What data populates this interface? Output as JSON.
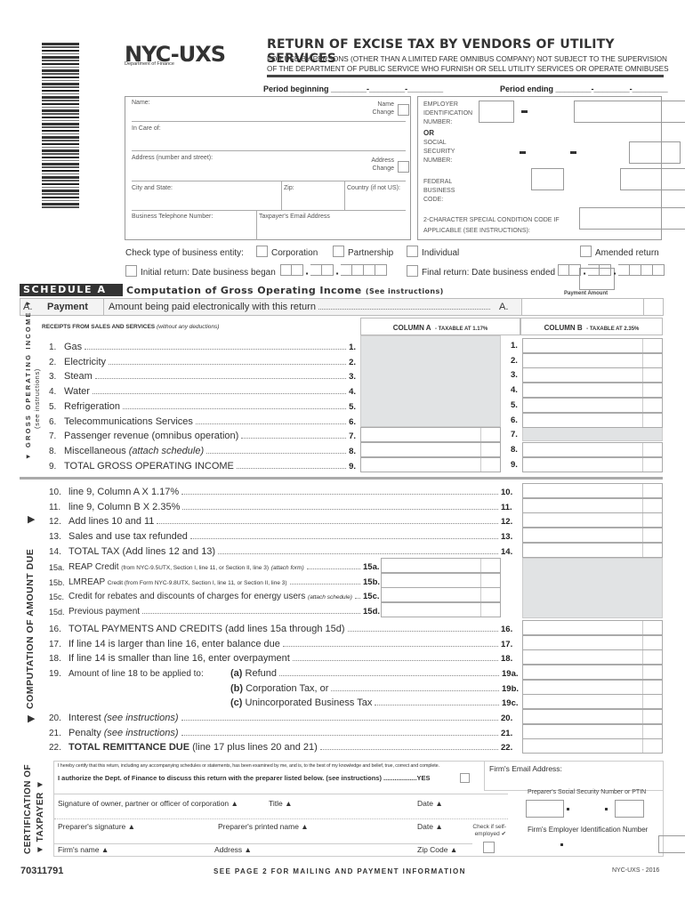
{
  "header": {
    "logo": "NYC-UXS",
    "logo_sub": "Department of Finance",
    "title": "RETURN OF EXCISE TAX BY VENDORS OF UTILITY SERVICES",
    "subtitle_line1": "FOR USE BY PERSONS (OTHER THAN A LIMITED FARE OMNIBUS COMPANY) NOT SUBJECT TO THE SUPERVISION",
    "subtitle_line2": "OF THE DEPARTMENT OF PUBLIC SERVICE WHO FURNISH OR SELL UTILITY SERVICES OR OPERATE OMNIBUSES",
    "period_beginning": "Period beginning ________-________-________",
    "period_ending": "Period ending ________-________-________"
  },
  "taxpayer": {
    "name_label": "Name:",
    "name_change_label": "Name Change",
    "in_care_of_label": "In Care of:",
    "address_label": "Address (number and street):",
    "address_change_label": "Address Change",
    "city_state_label": "City and State:",
    "zip_label": "Zip:",
    "country_label": "Country (if not US):",
    "phone_label": "Business Telephone Number:",
    "email_label": "Taxpayer's Email Address"
  },
  "ids": {
    "ein_label": "EMPLOYER IDENTIFICATION NUMBER:",
    "or_label": "OR",
    "ssn_label": "SOCIAL SECURITY NUMBER:",
    "fbc_label": "FEDERAL BUSINESS CODE:",
    "special_code_label": "2-CHARACTER SPECIAL CONDITION CODE IF APPLICABLE (SEE INSTRUCTIONS):"
  },
  "entity": {
    "prompt": "Check type of business entity:",
    "corporation": "Corporation",
    "partnership": "Partnership",
    "individual": "Individual",
    "amended": "Amended return",
    "initial": "Initial return:  Date business began",
    "final": "Final return: Date business ended"
  },
  "schedule": {
    "badge": "SCHEDULE A",
    "title": "Computation of Gross Operating Income",
    "title_note": "(See instructions)",
    "payment_amount_label": "Payment Amount",
    "payment_letter": "A.",
    "payment_label": "Payment",
    "payment_text": "Amount being paid electronically with this return",
    "payment_line": "A.",
    "receipts_header": "RECEIPTS FROM SALES AND SERVICES",
    "receipts_note": "(without any deductions)",
    "col_a": "COLUMN A",
    "col_a_rate": "TAXABLE AT 1.17%",
    "col_b": "COLUMN B",
    "col_b_rate": "TAXABLE AT 2.35%",
    "side_label": "GROSS OPERATING INCOME",
    "side_note": "(see instructions)",
    "lines": [
      {
        "num": "1.",
        "label": "Gas",
        "note": ""
      },
      {
        "num": "2.",
        "label": "Electricity",
        "note": ""
      },
      {
        "num": "3.",
        "label": "Steam",
        "note": ""
      },
      {
        "num": "4.",
        "label": "Water",
        "note": ""
      },
      {
        "num": "5.",
        "label": "Refrigeration",
        "note": ""
      },
      {
        "num": "6.",
        "label": "Telecommunications Services",
        "note": ""
      },
      {
        "num": "7.",
        "label": "Passenger revenue (omnibus operation)",
        "note": ""
      },
      {
        "num": "8.",
        "label": "Miscellaneous",
        "note": "(attach schedule)"
      },
      {
        "num": "9.",
        "label": "TOTAL GROSS OPERATING INCOME",
        "note": ""
      }
    ]
  },
  "computation": {
    "side_label": "COMPUTATION OF AMOUNT DUE",
    "lines": [
      {
        "num": "10.",
        "label": "line 9, Column A X 1.17%"
      },
      {
        "num": "11.",
        "label": "line 9, Column B X 2.35%"
      },
      {
        "num": "12.",
        "label": "Add lines 10 and 11"
      },
      {
        "num": "13.",
        "label": "Sales and use tax refunded"
      },
      {
        "num": "14.",
        "label": "TOTAL TAX (Add lines 12 and 13)"
      }
    ],
    "credits": [
      {
        "num": "15a.",
        "label": "REAP Credit",
        "note": "(from NYC-9.5UTX, Section I, line 11, or Section II, line 3)",
        "note2": "(attach form)"
      },
      {
        "num": "15b.",
        "label": "LMREAP",
        "note": "Credit (from Form NYC-9.8UTX, Section I, line 11, or Section II, line 3)",
        "note2": ""
      },
      {
        "num": "15c.",
        "label": "Credit for rebates and discounts of charges for energy users",
        "note": "",
        "note2": "(attach schedule)"
      },
      {
        "num": "15d.",
        "label": "Previous payment",
        "note": "",
        "note2": ""
      }
    ],
    "lines2": [
      {
        "num": "16.",
        "label": "TOTAL PAYMENTS AND CREDITS (add lines 15a through 15d)"
      },
      {
        "num": "17.",
        "label": "If line 14 is larger than line 16, enter balance due"
      },
      {
        "num": "18.",
        "label": "If line 14 is smaller than line 16, enter overpayment"
      },
      {
        "num": "19.",
        "label": "Amount of line 18 to be applied to:"
      }
    ],
    "line19": [
      {
        "num": "19a.",
        "letter": "(a)",
        "label": "Refund"
      },
      {
        "num": "19b.",
        "letter": "(b)",
        "label": "Corporation Tax, or"
      },
      {
        "num": "19c.",
        "letter": "(c)",
        "label": "Unincorporated Business Tax"
      }
    ],
    "lines3": [
      {
        "num": "20.",
        "label": "Interest",
        "note": "(see instructions)"
      },
      {
        "num": "21.",
        "label": "Penalty",
        "note": "(see instructions)"
      },
      {
        "num": "22.",
        "label": "TOTAL REMITTANCE DUE",
        "note": "(line 17 plus lines 20 and 21)"
      }
    ]
  },
  "certification": {
    "side_label1": "CERTIFICATION OF",
    "side_label2": "TAXPAYER",
    "certify_text": "I hereby certify that this return, including any accompanying schedules or statements, has been examined by me, and is, to the best of my knowledge and belief, true, correct and complete.",
    "authorize_text": "I authorize the Dept. of Finance to discuss this return with the preparer listed below. (see instructions) ..................YES",
    "firm_email_label": "Firm's Email Address:",
    "signature_label": "Signature of owner, partner  or officer of corporation ▲",
    "title_label": "Title ▲",
    "date_label": "Date ▲",
    "preparer_ssn_label": "Preparer's Social Security Number or PTIN",
    "preparer_sig_label": "Preparer's signature ▲",
    "preparer_name_label": "Preparer's printed name ▲",
    "date2_label": "Date ▲",
    "self_employed_label": "Check if self-employed ✔",
    "firm_ein_label": "Firm's Employer Identification Number",
    "firm_name_label": "Firm's name ▲",
    "address_label": "Address ▲",
    "zip_label": "Zip Code ▲"
  },
  "footer": {
    "form_number": "70311791",
    "mailing_note": "SEE PAGE 2 FOR MAILING AND PAYMENT INFORMATION",
    "form_year": "NYC-UXS - 2016"
  }
}
